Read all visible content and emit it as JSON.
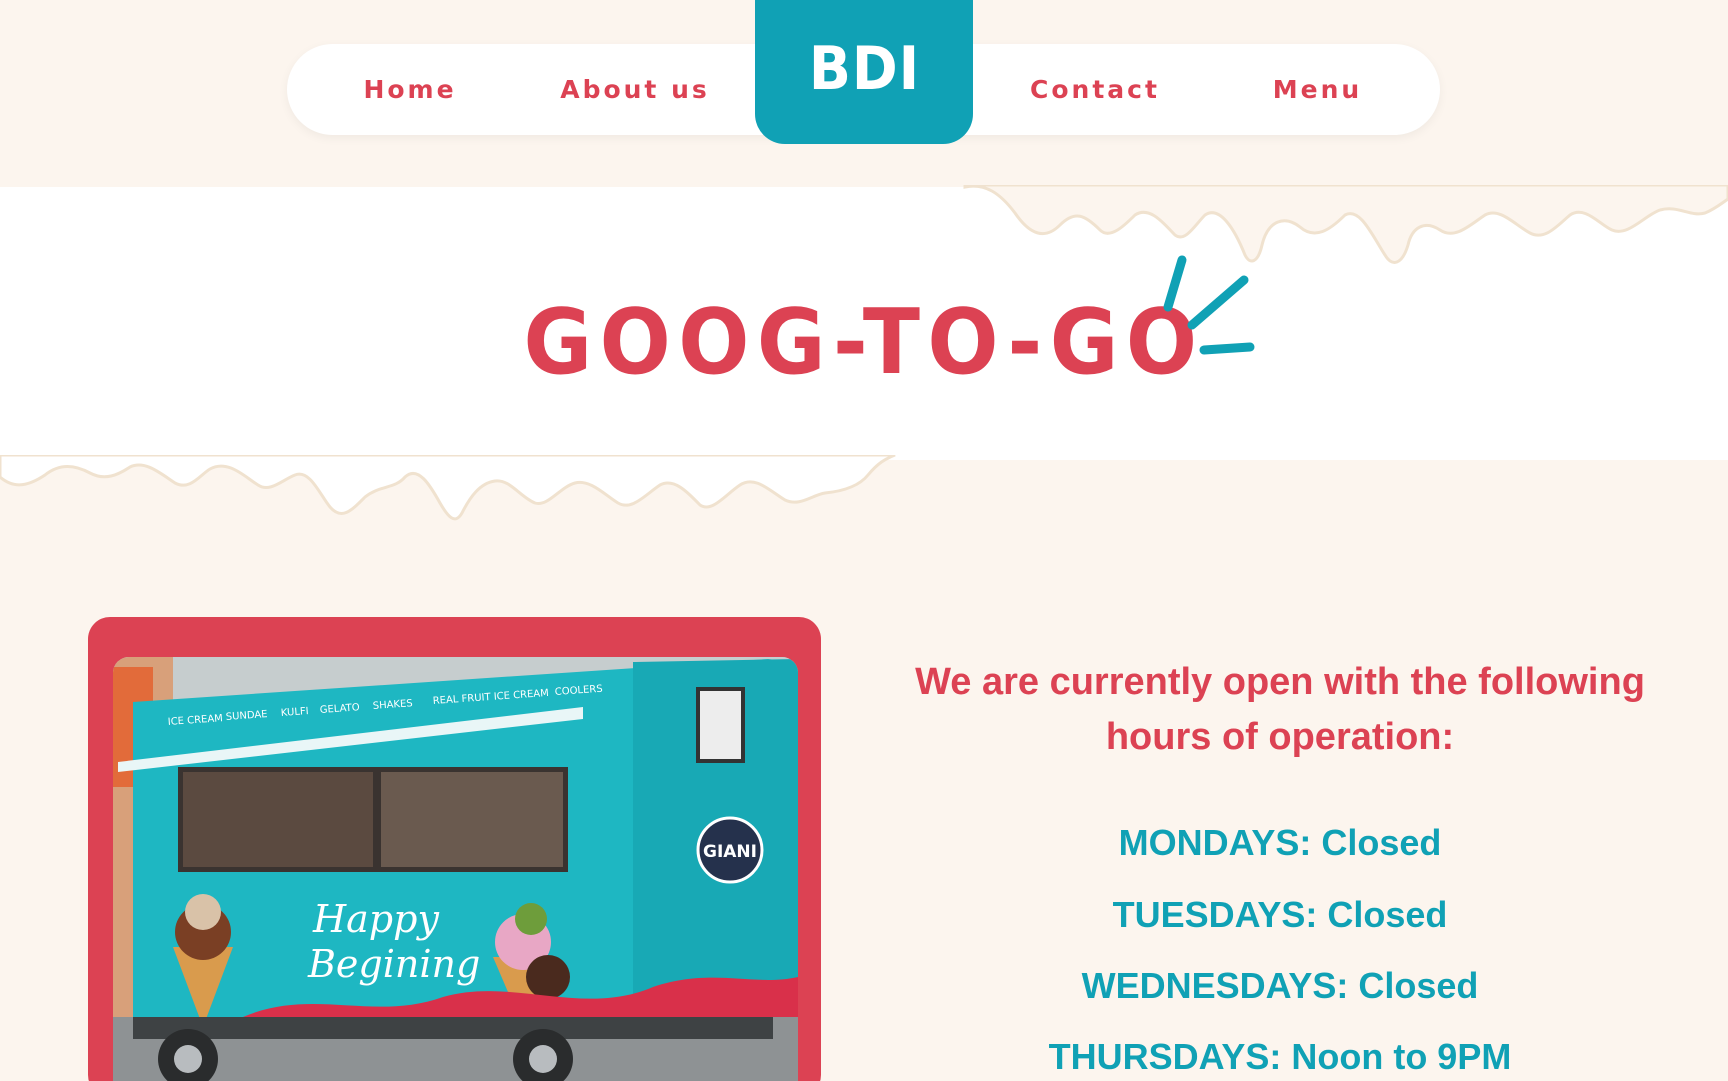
{
  "nav": {
    "links": [
      {
        "label": "Home"
      },
      {
        "label": "About us"
      },
      {
        "label": "Contact"
      },
      {
        "label": "Menu"
      }
    ],
    "logo": "BDI"
  },
  "hero": {
    "title": "GOOG-TO-GO"
  },
  "photo": {
    "truck_slogan_line1": "Happy",
    "truck_slogan_line2": "Begining",
    "truck_brand": "GIANI",
    "truck_top_labels": [
      "ICE CREAM",
      "SUNDAE",
      "KULFI",
      "GELATO",
      "SHAKES",
      "REAL FRUIT ICE CREAM",
      "COOLERS"
    ]
  },
  "hours": {
    "intro": "We are currently open with the following hours of operation:",
    "days": [
      "MONDAYS: Closed",
      "TUESDAYS: Closed",
      "WEDNESDAYS: Closed",
      "THURSDAYS: Noon to 9PM"
    ]
  },
  "colors": {
    "background": "#fcf5ee",
    "brand_red": "#dc4253",
    "brand_teal": "#10a1b5",
    "white": "#ffffff"
  }
}
